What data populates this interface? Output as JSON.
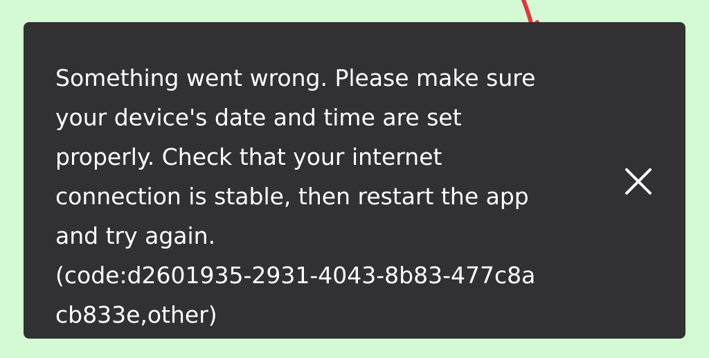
{
  "background_color": "#d3fad2",
  "snackbar": {
    "background_color": "#313033",
    "text_color": "#ffffff",
    "message_lines": [
      "Something went wrong. Please make sure",
      "your device's date and time are set",
      "properly. Check that your internet",
      "connection is stable, then restart the app",
      "and try again.",
      "(code:d2601935-2931-4043-8b83-477c8a",
      "cb833e,other)"
    ],
    "close_icon": "close-icon"
  },
  "annotation": {
    "color": "#e8323c",
    "icon": "arrow-annotation-icon"
  }
}
